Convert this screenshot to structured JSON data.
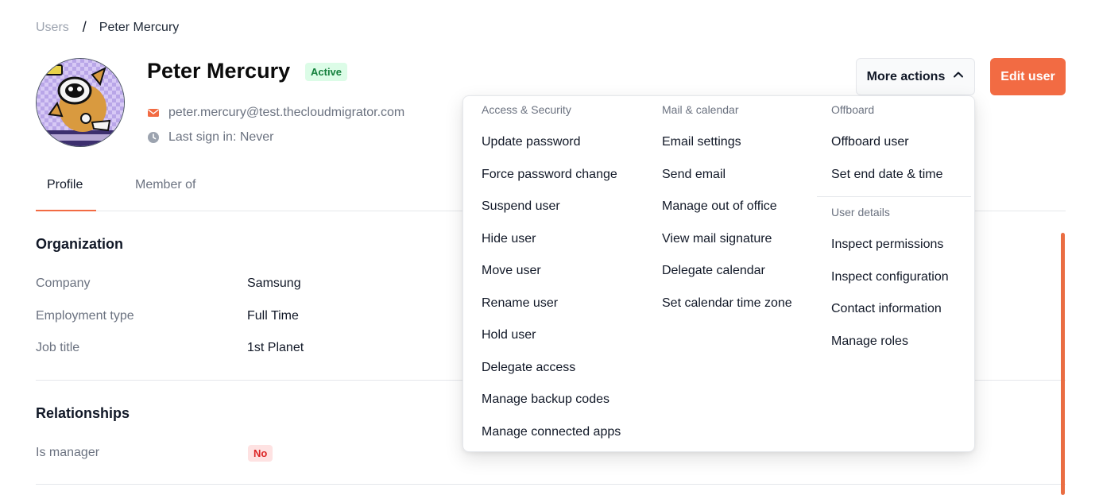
{
  "breadcrumb": {
    "root": "Users",
    "separator": "/",
    "current": "Peter Mercury"
  },
  "user": {
    "name": "Peter Mercury",
    "status": "Active",
    "email": "peter.mercury@test.thecloudmigrator.com",
    "last_sign_in": "Last sign in: Never"
  },
  "icons": {
    "email": "mail-icon",
    "clock": "clock-icon",
    "chevron": "chevron-up-icon"
  },
  "tabs": [
    {
      "label": "Profile"
    },
    {
      "label": "Member of"
    }
  ],
  "organization": {
    "title": "Organization",
    "fields": [
      {
        "label": "Company",
        "value": "Samsung"
      },
      {
        "label": "Employment type",
        "value": "Full Time"
      },
      {
        "label": "Job title",
        "value": "1st Planet"
      }
    ]
  },
  "relationships": {
    "title": "Relationships",
    "fields": [
      {
        "label": "Is manager",
        "value": "No"
      }
    ]
  },
  "header_buttons": {
    "more_actions": "More actions",
    "edit_user": "Edit user"
  },
  "menu": {
    "access_security": {
      "heading": "Access & Security",
      "items": [
        "Update password",
        "Force password change",
        "Suspend user",
        "Hide user",
        "Move user",
        "Rename user",
        "Hold user",
        "Delegate access",
        "Manage backup codes",
        "Manage connected apps"
      ]
    },
    "mail_calendar": {
      "heading": "Mail & calendar",
      "items": [
        "Email settings",
        "Send email",
        "Manage out of office",
        "View mail signature",
        "Delegate calendar",
        "Set calendar time zone"
      ]
    },
    "offboard": {
      "heading": "Offboard",
      "items": [
        "Offboard user",
        "Set end date & time"
      ]
    },
    "user_details": {
      "heading": "User details",
      "items": [
        "Inspect permissions",
        "Inspect configuration",
        "Contact information",
        "Manage roles"
      ]
    }
  },
  "colors": {
    "accent": "#f26b43",
    "active_bg": "#dcfce7",
    "active_fg": "#15803d",
    "no_bg": "#fee2e2",
    "no_fg": "#dc2626"
  }
}
